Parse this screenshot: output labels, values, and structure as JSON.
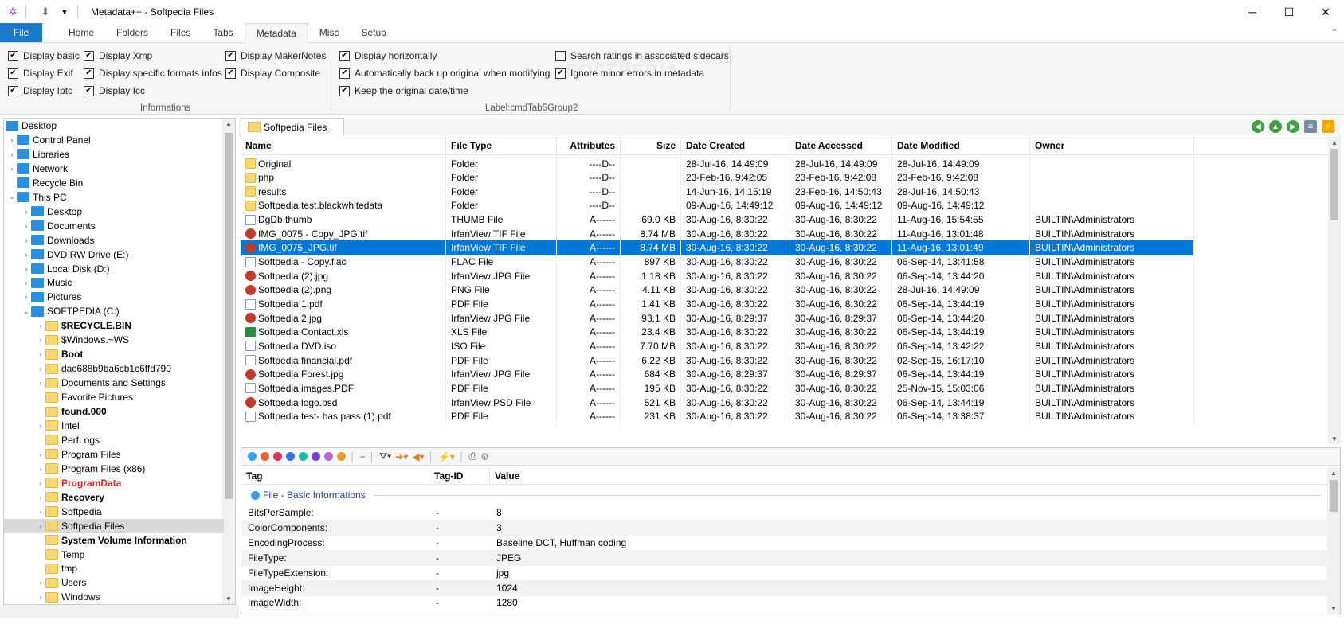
{
  "window": {
    "title": "Metadata++ - Softpedia Files",
    "minimize": "─",
    "maximize": "☐",
    "close": "✕"
  },
  "tabs": {
    "file": "File",
    "items": [
      "Home",
      "Folders",
      "Files",
      "Tabs",
      "Metadata",
      "Misc",
      "Setup"
    ],
    "active_index": 4
  },
  "ribbon": {
    "watermark": "SOFTPEDIA",
    "group1_label": "Informations",
    "group2_label": "Label:cmdTab5Group2",
    "checks": [
      {
        "label": "Display basic",
        "checked": true
      },
      {
        "label": "Display Exif",
        "checked": true
      },
      {
        "label": "Display Iptc",
        "checked": true
      },
      {
        "label": "Display Xmp",
        "checked": true
      },
      {
        "label": "Display specific formats infos",
        "checked": true
      },
      {
        "label": "Display Icc",
        "checked": true
      },
      {
        "label": "Display MakerNotes",
        "checked": true
      },
      {
        "label": "Display Composite",
        "checked": true
      },
      {
        "label": "Display horizontally",
        "checked": true
      },
      {
        "label": "Automatically back up original when modifying",
        "checked": true
      },
      {
        "label": "Keep the original date/time",
        "checked": true
      },
      {
        "label": "Search ratings in associated sidecars",
        "checked": false
      },
      {
        "label": "Ignore minor errors in metadata",
        "checked": true
      }
    ]
  },
  "tree": [
    {
      "label": "Desktop",
      "level": 0,
      "icon": "desktop-icon",
      "chev": ""
    },
    {
      "label": "Control Panel",
      "level": 1,
      "icon": "control-panel-icon",
      "chev": "›"
    },
    {
      "label": "Libraries",
      "level": 1,
      "icon": "libraries-icon",
      "chev": "›"
    },
    {
      "label": "Network",
      "level": 1,
      "icon": "network-icon",
      "chev": "›"
    },
    {
      "label": "Recycle Bin",
      "level": 1,
      "icon": "recycle-bin-icon",
      "chev": ""
    },
    {
      "label": "This PC",
      "level": 1,
      "icon": "pc-icon",
      "chev": "⌄"
    },
    {
      "label": "Desktop",
      "level": 2,
      "icon": "desktop-icon",
      "chev": "›"
    },
    {
      "label": "Documents",
      "level": 2,
      "icon": "documents-icon",
      "chev": "›"
    },
    {
      "label": "Downloads",
      "level": 2,
      "icon": "downloads-icon",
      "chev": "›"
    },
    {
      "label": "DVD RW Drive (E:)",
      "level": 2,
      "icon": "dvd-drive-icon",
      "chev": "›"
    },
    {
      "label": "Local Disk (D:)",
      "level": 2,
      "icon": "disk-icon",
      "chev": "›"
    },
    {
      "label": "Music",
      "level": 2,
      "icon": "music-icon",
      "chev": "›"
    },
    {
      "label": "Pictures",
      "level": 2,
      "icon": "pictures-icon",
      "chev": "›"
    },
    {
      "label": "SOFTPEDIA (C:)",
      "level": 2,
      "icon": "disk-icon",
      "chev": "⌄"
    },
    {
      "label": "$RECYCLE.BIN",
      "level": 3,
      "icon": "folder-icon",
      "chev": "›",
      "style": "bold"
    },
    {
      "label": "$Windows.~WS",
      "level": 3,
      "icon": "folder-icon",
      "chev": "›"
    },
    {
      "label": "Boot",
      "level": 3,
      "icon": "folder-icon",
      "chev": "›",
      "style": "bold"
    },
    {
      "label": "dac688b9ba6cb1c6ffd790",
      "level": 3,
      "icon": "folder-icon",
      "chev": "›"
    },
    {
      "label": "Documents and Settings",
      "level": 3,
      "icon": "folder-icon",
      "chev": "›"
    },
    {
      "label": "Favorite Pictures",
      "level": 3,
      "icon": "folder-icon",
      "chev": ""
    },
    {
      "label": "found.000",
      "level": 3,
      "icon": "folder-icon",
      "chev": "",
      "style": "bold"
    },
    {
      "label": "Intel",
      "level": 3,
      "icon": "folder-icon",
      "chev": "›"
    },
    {
      "label": "PerfLogs",
      "level": 3,
      "icon": "folder-icon",
      "chev": ""
    },
    {
      "label": "Program Files",
      "level": 3,
      "icon": "folder-icon",
      "chev": "›"
    },
    {
      "label": "Program Files (x86)",
      "level": 3,
      "icon": "folder-icon",
      "chev": "›"
    },
    {
      "label": "ProgramData",
      "level": 3,
      "icon": "folder-icon",
      "chev": "›",
      "style": "red"
    },
    {
      "label": "Recovery",
      "level": 3,
      "icon": "folder-icon",
      "chev": "›",
      "style": "bold"
    },
    {
      "label": "Softpedia",
      "level": 3,
      "icon": "folder-icon",
      "chev": "›"
    },
    {
      "label": "Softpedia Files",
      "level": 3,
      "icon": "folder-icon",
      "chev": "›",
      "selected": true
    },
    {
      "label": "System Volume Information",
      "level": 3,
      "icon": "folder-icon",
      "chev": "",
      "style": "bold"
    },
    {
      "label": "Temp",
      "level": 3,
      "icon": "folder-icon",
      "chev": ""
    },
    {
      "label": "tmp",
      "level": 3,
      "icon": "folder-icon",
      "chev": ""
    },
    {
      "label": "Users",
      "level": 3,
      "icon": "folder-icon",
      "chev": "›"
    },
    {
      "label": "Windows",
      "level": 3,
      "icon": "folder-icon",
      "chev": "›"
    }
  ],
  "doc_tab": "Softpedia Files",
  "file_columns": [
    "Name",
    "File Type",
    "Attributes",
    "Size",
    "Date Created",
    "Date Accessed",
    "Date Modified",
    "Owner"
  ],
  "files": [
    {
      "name": "Original",
      "type": "Folder",
      "attr": "----D--",
      "size": "",
      "created": "28-Jul-16, 14:49:09",
      "accessed": "28-Jul-16, 14:49:09",
      "modified": "28-Jul-16, 14:49:09",
      "owner": "",
      "icon": "folder"
    },
    {
      "name": "php",
      "type": "Folder",
      "attr": "----D--",
      "size": "",
      "created": "23-Feb-16, 9:42:05",
      "accessed": "23-Feb-16, 9:42:08",
      "modified": "23-Feb-16, 9:42:08",
      "owner": "",
      "icon": "folder"
    },
    {
      "name": "results",
      "type": "Folder",
      "attr": "----D--",
      "size": "",
      "created": "14-Jun-16, 14:15:19",
      "accessed": "23-Feb-16, 14:50:43",
      "modified": "28-Jul-16, 14:50:43",
      "owner": "",
      "icon": "folder"
    },
    {
      "name": "Softpedia test.blackwhitedata",
      "type": "Folder",
      "attr": "----D--",
      "size": "",
      "created": "09-Aug-16, 14:49:12",
      "accessed": "09-Aug-16, 14:49:12",
      "modified": "09-Aug-16, 14:49:12",
      "owner": "",
      "icon": "folder"
    },
    {
      "name": "DgDb.thumb",
      "type": "THUMB File",
      "attr": "A------",
      "size": "69.0 KB",
      "created": "30-Aug-16, 8:30:22",
      "accessed": "30-Aug-16, 8:30:22",
      "modified": "11-Aug-16, 15:54:55",
      "owner": "BUILTIN\\Administrators",
      "icon": "file"
    },
    {
      "name": "IMG_0075 - Copy_JPG.tif",
      "type": "IrfanView TIF File",
      "attr": "A------",
      "size": "8.74 MB",
      "created": "30-Aug-16, 8:30:22",
      "accessed": "30-Aug-16, 8:30:22",
      "modified": "11-Aug-16, 13:01:48",
      "owner": "BUILTIN\\Administrators",
      "icon": "irfan"
    },
    {
      "name": "IMG_0075_JPG.tif",
      "type": "IrfanView TIF File",
      "attr": "A------",
      "size": "8.74 MB",
      "created": "30-Aug-16, 8:30:22",
      "accessed": "30-Aug-16, 8:30:22",
      "modified": "11-Aug-16, 13:01:49",
      "owner": "BUILTIN\\Administrators",
      "icon": "irfan",
      "selected": true
    },
    {
      "name": "Softpedia - Copy.flac",
      "type": "FLAC File",
      "attr": "A------",
      "size": "897 KB",
      "created": "30-Aug-16, 8:30:22",
      "accessed": "30-Aug-16, 8:30:22",
      "modified": "06-Sep-14, 13:41:58",
      "owner": "BUILTIN\\Administrators",
      "icon": "file"
    },
    {
      "name": "Softpedia (2).jpg",
      "type": "IrfanView JPG File",
      "attr": "A------",
      "size": "1.18 KB",
      "created": "30-Aug-16, 8:30:22",
      "accessed": "30-Aug-16, 8:30:22",
      "modified": "06-Sep-14, 13:44:20",
      "owner": "BUILTIN\\Administrators",
      "icon": "irfan"
    },
    {
      "name": "Softpedia (2).png",
      "type": "PNG File",
      "attr": "A------",
      "size": "4.11 KB",
      "created": "30-Aug-16, 8:30:22",
      "accessed": "30-Aug-16, 8:30:22",
      "modified": "28-Jul-16, 14:49:09",
      "owner": "BUILTIN\\Administrators",
      "icon": "irfan"
    },
    {
      "name": "Softpedia 1.pdf",
      "type": "PDF File",
      "attr": "A------",
      "size": "1.41 KB",
      "created": "30-Aug-16, 8:30:22",
      "accessed": "30-Aug-16, 8:30:22",
      "modified": "06-Sep-14, 13:44:19",
      "owner": "BUILTIN\\Administrators",
      "icon": "file"
    },
    {
      "name": "Softpedia 2.jpg",
      "type": "IrfanView JPG File",
      "attr": "A------",
      "size": "93.1 KB",
      "created": "30-Aug-16, 8:29:37",
      "accessed": "30-Aug-16, 8:29:37",
      "modified": "06-Sep-14, 13:44:20",
      "owner": "BUILTIN\\Administrators",
      "icon": "irfan"
    },
    {
      "name": "Softpedia Contact.xls",
      "type": "XLS File",
      "attr": "A------",
      "size": "23.4 KB",
      "created": "30-Aug-16, 8:30:22",
      "accessed": "30-Aug-16, 8:30:22",
      "modified": "06-Sep-14, 13:44:19",
      "owner": "BUILTIN\\Administrators",
      "icon": "xls"
    },
    {
      "name": "Softpedia DVD.iso",
      "type": "ISO File",
      "attr": "A------",
      "size": "7.70 MB",
      "created": "30-Aug-16, 8:30:22",
      "accessed": "30-Aug-16, 8:30:22",
      "modified": "06-Sep-14, 13:42:22",
      "owner": "BUILTIN\\Administrators",
      "icon": "file"
    },
    {
      "name": "Softpedia financial.pdf",
      "type": "PDF File",
      "attr": "A------",
      "size": "6.22 KB",
      "created": "30-Aug-16, 8:30:22",
      "accessed": "30-Aug-16, 8:30:22",
      "modified": "02-Sep-15, 16:17:10",
      "owner": "BUILTIN\\Administrators",
      "icon": "file"
    },
    {
      "name": "Softpedia Forest.jpg",
      "type": "IrfanView JPG File",
      "attr": "A------",
      "size": "684 KB",
      "created": "30-Aug-16, 8:29:37",
      "accessed": "30-Aug-16, 8:29:37",
      "modified": "06-Sep-14, 13:44:19",
      "owner": "BUILTIN\\Administrators",
      "icon": "irfan"
    },
    {
      "name": "Softpedia images.PDF",
      "type": "PDF File",
      "attr": "A------",
      "size": "195 KB",
      "created": "30-Aug-16, 8:30:22",
      "accessed": "30-Aug-16, 8:30:22",
      "modified": "25-Nov-15, 15:03:06",
      "owner": "BUILTIN\\Administrators",
      "icon": "file"
    },
    {
      "name": "Softpedia logo.psd",
      "type": "IrfanView PSD File",
      "attr": "A------",
      "size": "521 KB",
      "created": "30-Aug-16, 8:30:22",
      "accessed": "30-Aug-16, 8:30:22",
      "modified": "06-Sep-14, 13:44:19",
      "owner": "BUILTIN\\Administrators",
      "icon": "irfan"
    },
    {
      "name": "Softpedia test- has pass (1).pdf",
      "type": "PDF File",
      "attr": "A------",
      "size": "231 KB",
      "created": "30-Aug-16, 8:30:22",
      "accessed": "30-Aug-16, 8:30:22",
      "modified": "06-Sep-14, 13:38:37",
      "owner": "BUILTIN\\Administrators",
      "icon": "file"
    }
  ],
  "meta_columns": [
    "Tag",
    "Tag-ID",
    "Value"
  ],
  "meta_section": "File - Basic Informations",
  "meta_rows": [
    {
      "tag": "BitsPerSample:",
      "id": "-",
      "value": "8"
    },
    {
      "tag": "ColorComponents:",
      "id": "-",
      "value": "3"
    },
    {
      "tag": "EncodingProcess:",
      "id": "-",
      "value": "Baseline DCT, Huffman coding"
    },
    {
      "tag": "FileType:",
      "id": "-",
      "value": "JPEG"
    },
    {
      "tag": "FileTypeExtension:",
      "id": "-",
      "value": "jpg"
    },
    {
      "tag": "ImageHeight:",
      "id": "-",
      "value": "1024"
    },
    {
      "tag": "ImageWidth:",
      "id": "-",
      "value": "1280"
    }
  ],
  "colors": {
    "accent": "#0078d7",
    "file_tab": "#1979ca",
    "ribbon_bg": "#f5f6f7"
  },
  "color_dots": [
    "#3aa0e8",
    "#e8622b",
    "#d9335c",
    "#3474d4",
    "#23b7a8",
    "#7a3fc9",
    "#b466c9",
    "#e0a030"
  ]
}
